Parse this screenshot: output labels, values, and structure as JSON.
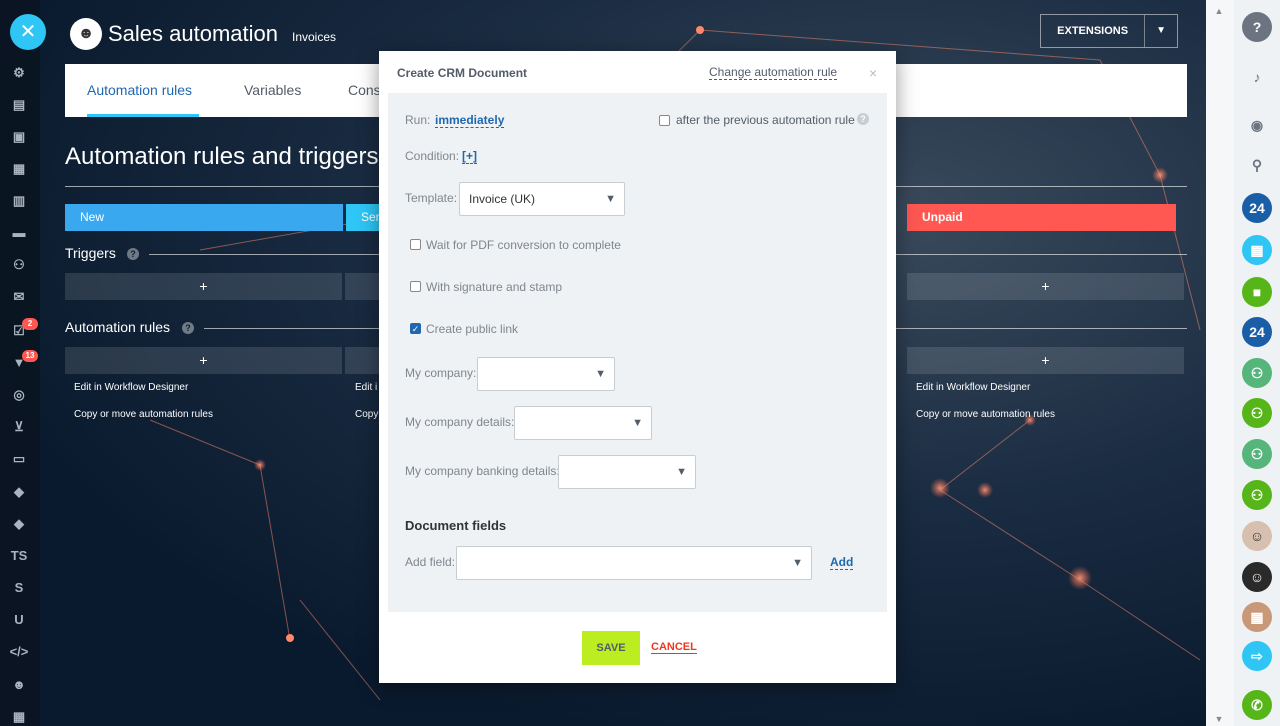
{
  "header": {
    "title": "Sales automation",
    "subtitle": "Invoices",
    "extensions_label": "EXTENSIONS"
  },
  "tabs": [
    {
      "label": "Automation rules"
    },
    {
      "label": "Variables"
    },
    {
      "label": "Cons"
    }
  ],
  "page": {
    "section_title": "Automation rules and triggers",
    "stages": [
      {
        "label": "New",
        "color": "#39a8ef"
      },
      {
        "label": "Ser",
        "color": "#2fc6f6"
      },
      {
        "label": "Unpaid",
        "color": "#ff5752"
      }
    ],
    "triggers_label": "Triggers",
    "automation_rules_label": "Automation rules",
    "plus": "+",
    "edit_link": "Edit in Workflow Designer",
    "copy_link": "Copy or move automation rules",
    "edit_link_short": "Edit i",
    "copy_link_short": "Copy"
  },
  "left_sidebar": {
    "badges": [
      "2",
      "13"
    ],
    "text_items": [
      "TS",
      "S",
      "U"
    ]
  },
  "right_sidebar": {
    "items": [
      "24",
      "24"
    ]
  },
  "dialog": {
    "title": "Create CRM Document",
    "change_rule": "Change automation rule",
    "close": "×",
    "run_label": "Run:",
    "run_value": "immediately",
    "after_previous": "after the previous automation rule",
    "condition_label": "Condition:",
    "condition_value": "[+]",
    "template_label": "Template:",
    "template_value": "Invoice (UK)",
    "wait_pdf": "Wait for PDF conversion to complete",
    "with_signature": "With signature and stamp",
    "create_public_link": "Create public link",
    "my_company_label": "My company:",
    "my_company_details_label": "My company details:",
    "my_company_banking_label": "My company banking details:",
    "document_fields_title": "Document fields",
    "add_field_label": "Add field:",
    "add_label": "Add",
    "save_label": "SAVE",
    "cancel_label": "CANCEL"
  }
}
